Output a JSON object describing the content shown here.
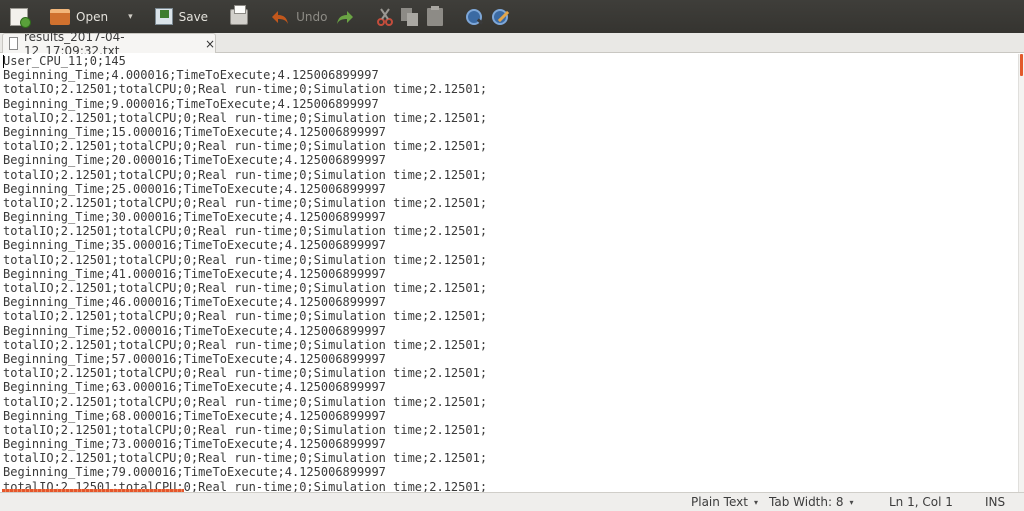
{
  "toolbar": {
    "new_icon": "new-document-icon",
    "open_label": "Open",
    "open_caret": "▾",
    "save_label": "Save",
    "undo_label": "Undo",
    "colors": {
      "background": "#3a3935",
      "text": "#e4e2dc",
      "disabled_text": "#8d8b85",
      "undo_arrow": "#c2571c",
      "redo_arrow": "#6aa344"
    }
  },
  "tab": {
    "title": "results_2017-04-12_17:09:32.txt",
    "close": "×"
  },
  "editor": {
    "lines": [
      "User_CPU_11;0;145",
      "Beginning_Time;4.000016;TimeToExecute;4.125006899997",
      "totalIO;2.12501;totalCPU;0;Real run-time;0;Simulation time;2.12501;",
      "Beginning_Time;9.000016;TimeToExecute;4.125006899997",
      "totalIO;2.12501;totalCPU;0;Real run-time;0;Simulation time;2.12501;",
      "Beginning_Time;15.000016;TimeToExecute;4.125006899997",
      "totalIO;2.12501;totalCPU;0;Real run-time;0;Simulation time;2.12501;",
      "Beginning_Time;20.000016;TimeToExecute;4.125006899997",
      "totalIO;2.12501;totalCPU;0;Real run-time;0;Simulation time;2.12501;",
      "Beginning_Time;25.000016;TimeToExecute;4.125006899997",
      "totalIO;2.12501;totalCPU;0;Real run-time;0;Simulation time;2.12501;",
      "Beginning_Time;30.000016;TimeToExecute;4.125006899997",
      "totalIO;2.12501;totalCPU;0;Real run-time;0;Simulation time;2.12501;",
      "Beginning_Time;35.000016;TimeToExecute;4.125006899997",
      "totalIO;2.12501;totalCPU;0;Real run-time;0;Simulation time;2.12501;",
      "Beginning_Time;41.000016;TimeToExecute;4.125006899997",
      "totalIO;2.12501;totalCPU;0;Real run-time;0;Simulation time;2.12501;",
      "Beginning_Time;46.000016;TimeToExecute;4.125006899997",
      "totalIO;2.12501;totalCPU;0;Real run-time;0;Simulation time;2.12501;",
      "Beginning_Time;52.000016;TimeToExecute;4.125006899997",
      "totalIO;2.12501;totalCPU;0;Real run-time;0;Simulation time;2.12501;",
      "Beginning_Time;57.000016;TimeToExecute;4.125006899997",
      "totalIO;2.12501;totalCPU;0;Real run-time;0;Simulation time;2.12501;",
      "Beginning_Time;63.000016;TimeToExecute;4.125006899997",
      "totalIO;2.12501;totalCPU;0;Real run-time;0;Simulation time;2.12501;",
      "Beginning_Time;68.000016;TimeToExecute;4.125006899997",
      "totalIO;2.12501;totalCPU;0;Real run-time;0;Simulation time;2.12501;",
      "Beginning_Time;73.000016;TimeToExecute;4.125006899997",
      "totalIO;2.12501;totalCPU;0;Real run-time;0;Simulation time;2.12501;",
      "Beginning_Time;79.000016;TimeToExecute;4.125006899997",
      "totalIO;2.12501;totalCPU;0;Real run-time;0;Simulation time;2.12501;"
    ]
  },
  "statusbar": {
    "language": "Plain Text",
    "tab_width": "Tab Width: 8",
    "position": "Ln 1, Col 1",
    "mode": "INS",
    "caret": "▾"
  },
  "colors": {
    "accent": "#e2592b",
    "spell_underline": "#e5562c"
  }
}
